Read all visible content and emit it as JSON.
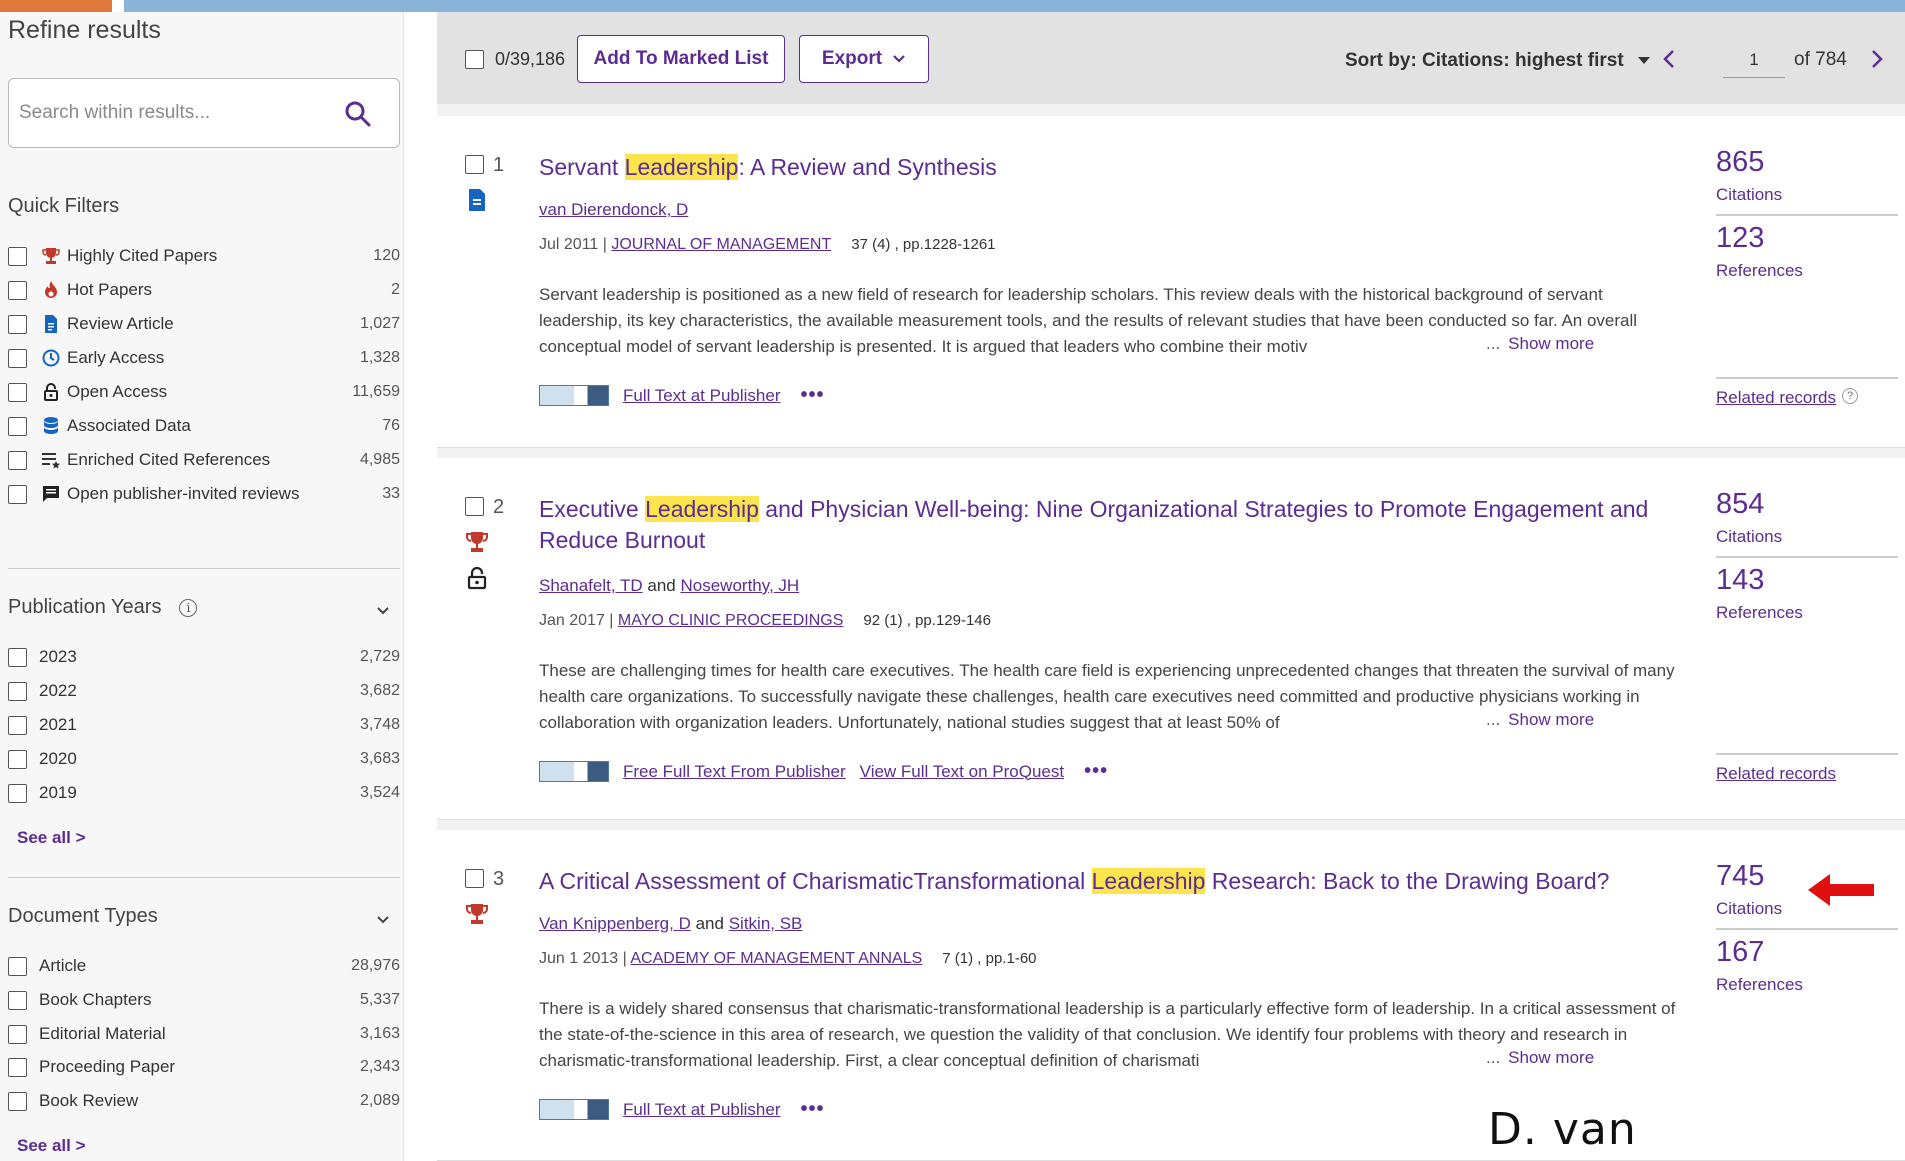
{
  "sidebar": {
    "title": "Refine results",
    "search_placeholder": "Search within results...",
    "quick_filters": {
      "title": "Quick Filters",
      "items": [
        {
          "label": "Highly Cited Papers",
          "count": "120",
          "icon": "trophy-icon",
          "color": "#c0392b"
        },
        {
          "label": "Hot Papers",
          "count": "2",
          "icon": "flame-icon",
          "color": "#c0392b"
        },
        {
          "label": "Review Article",
          "count": "1,027",
          "icon": "document-icon",
          "color": "#1565c0"
        },
        {
          "label": "Early Access",
          "count": "1,328",
          "icon": "clock-icon",
          "color": "#1565c0"
        },
        {
          "label": "Open Access",
          "count": "11,659",
          "icon": "unlock-icon",
          "color": "#222222"
        },
        {
          "label": "Associated Data",
          "count": "76",
          "icon": "database-icon",
          "color": "#1565c0"
        },
        {
          "label": "Enriched Cited References",
          "count": "4,985",
          "icon": "list-star-icon",
          "color": "#333333"
        },
        {
          "label": "Open publisher-invited reviews",
          "count": "33",
          "icon": "comment-icon",
          "color": "#222222"
        }
      ]
    },
    "publication_years": {
      "title": "Publication Years",
      "items": [
        {
          "label": "2023",
          "count": "2,729"
        },
        {
          "label": "2022",
          "count": "3,682"
        },
        {
          "label": "2021",
          "count": "3,748"
        },
        {
          "label": "2020",
          "count": "3,683"
        },
        {
          "label": "2019",
          "count": "3,524"
        }
      ],
      "see_all": "See all >"
    },
    "document_types": {
      "title": "Document Types",
      "items": [
        {
          "label": "Article",
          "count": "28,976"
        },
        {
          "label": "Book Chapters",
          "count": "5,337"
        },
        {
          "label": "Editorial Material",
          "count": "3,163"
        },
        {
          "label": "Proceeding Paper",
          "count": "2,343"
        },
        {
          "label": "Book Review",
          "count": "2,089"
        }
      ],
      "see_all": "See all >"
    }
  },
  "toolbar": {
    "selected_count": "0/39,186",
    "add_button": "Add To Marked List",
    "export_button": "Export",
    "sort_label": "Sort by: Citations: highest first",
    "page_value": "1",
    "page_total": "of 784"
  },
  "records": [
    {
      "number": "1",
      "title_before": "Servant ",
      "title_highlight": "Leadership",
      "title_after": ": A Review and Synthesis",
      "authors": [
        "van Dierendonck, D"
      ],
      "date": "Jul 2011",
      "journal": "JOURNAL OF MANAGEMENT",
      "volume": "37 (4) , pp.1228-1261",
      "abstract": "Servant leadership is positioned as a new field of research for leadership scholars. This review deals with the historical background of servant leadership, its key characteristics, the available measurement tools, and the results of relevant studies that have been conducted so far. An overall conceptual model of servant leadership is presented. It is argued that leaders who combine their motiv",
      "show_more": "Show more",
      "links": [
        "Full Text at Publisher"
      ],
      "citations": "865",
      "citations_label": "Citations",
      "references": "123",
      "references_label": "References",
      "related": "Related records"
    },
    {
      "number": "2",
      "title_before": "Executive ",
      "title_highlight": "Leadership",
      "title_after": " and Physician Well-being: Nine Organizational Strategies to Promote Engagement and Reduce Burnout",
      "authors": [
        "Shanafelt, TD",
        "Noseworthy, JH"
      ],
      "author_join": "and",
      "date": "Jan 2017",
      "journal": "MAYO CLINIC PROCEEDINGS",
      "volume": "92 (1) , pp.129-146",
      "abstract": "These are challenging times for health care executives. The health care field is experiencing unprecedented changes that threaten the survival of many health care organizations. To successfully navigate these challenges, health care executives need committed and productive physicians working in collaboration with organization leaders. Unfortunately, national studies suggest that at least 50% of",
      "show_more": "Show more",
      "links": [
        "Free Full Text From Publisher",
        "View Full Text on ProQuest"
      ],
      "citations": "854",
      "citations_label": "Citations",
      "references": "143",
      "references_label": "References",
      "related": "Related records"
    },
    {
      "number": "3",
      "title_before": "A Critical Assessment of CharismaticTransformational ",
      "title_highlight": "Leadership",
      "title_after": " Research: Back to the Drawing Board?",
      "authors": [
        "Van Knippenberg, D",
        "Sitkin, SB"
      ],
      "author_join": "and",
      "date": "Jun 1 2013",
      "journal": "ACADEMY OF MANAGEMENT ANNALS",
      "volume": "7 (1) , pp.1-60",
      "abstract": "There is a widely shared consensus that charismatic-transformational leadership is a particularly effective form of leadership. In a critical assessment of the state-of-the-science in this area of research, we question the validity of that conclusion. We identify four problems with theory and research in charismatic-transformational leadership. First, a clear conceptual definition of charismati",
      "show_more": "Show more",
      "links": [
        "Full Text at Publisher"
      ],
      "citations": "745",
      "citations_label": "Citations",
      "references": "167",
      "references_label": "References"
    }
  ],
  "annotation": {
    "caption": "D. van Knippenberg",
    "arrow_color": "#e01010"
  },
  "colors": {
    "accent": "#5c2d91",
    "highlight": "#fce44d",
    "trophy": "#c0392b"
  },
  "ellipsis": "...",
  "more_dots": "•••",
  "help_mark": "?",
  "info_mark": "i"
}
